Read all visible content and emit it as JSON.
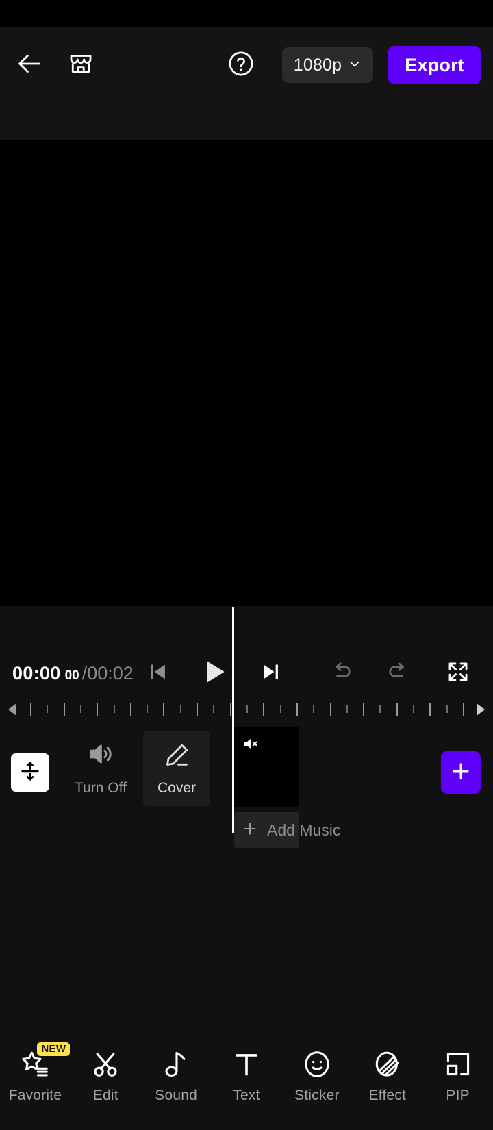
{
  "topbar": {
    "back_icon": "arrow-left-icon",
    "shop_icon": "storefront-icon",
    "help_icon": "help-circle-icon",
    "resolution": "1080p",
    "resolution_chevron": "chevron-down-icon",
    "export_label": "Export",
    "export_color": "#5f00fa"
  },
  "preview": {
    "background_color": "#000000"
  },
  "player": {
    "current_time": "00:00",
    "current_frames": "00",
    "total_time": "/00:02",
    "prev_frame_icon": "skip-previous-icon",
    "play_icon": "play-icon",
    "next_frame_icon": "skip-next-icon",
    "undo_icon": "undo-icon",
    "redo_icon": "redo-icon",
    "fullscreen_icon": "fullscreen-icon"
  },
  "ruler": {
    "left_arrow_icon": "scroll-left-arrow-icon",
    "right_arrow_icon": "scroll-right-arrow-icon",
    "tick_count": 27
  },
  "track": {
    "resize_icon": "vertical-resize-icon",
    "volume_icon": "volume-on-icon",
    "volume_label": "Turn Off",
    "cover_icon": "pencil-icon",
    "cover_label": "Cover",
    "clip_mute_icon": "volume-muted-icon",
    "add_music_icon": "plus-icon",
    "add_music_label": "Add Music",
    "add_clip_icon": "plus-icon",
    "add_clip_color": "#5f00fa"
  },
  "bottomnav": {
    "items": [
      {
        "label": "Favorite",
        "icon": "star-list-icon",
        "badge": "NEW"
      },
      {
        "label": "Edit",
        "icon": "scissors-icon",
        "badge": ""
      },
      {
        "label": "Sound",
        "icon": "music-note-icon",
        "badge": ""
      },
      {
        "label": "Text",
        "icon": "text-t-icon",
        "badge": ""
      },
      {
        "label": "Sticker",
        "icon": "smiley-face-icon",
        "badge": ""
      },
      {
        "label": "Effect",
        "icon": "effect-swirl-icon",
        "badge": ""
      },
      {
        "label": "PIP",
        "icon": "picture-in-picture-icon",
        "badge": ""
      }
    ],
    "badge_color": "#ffe14d"
  }
}
